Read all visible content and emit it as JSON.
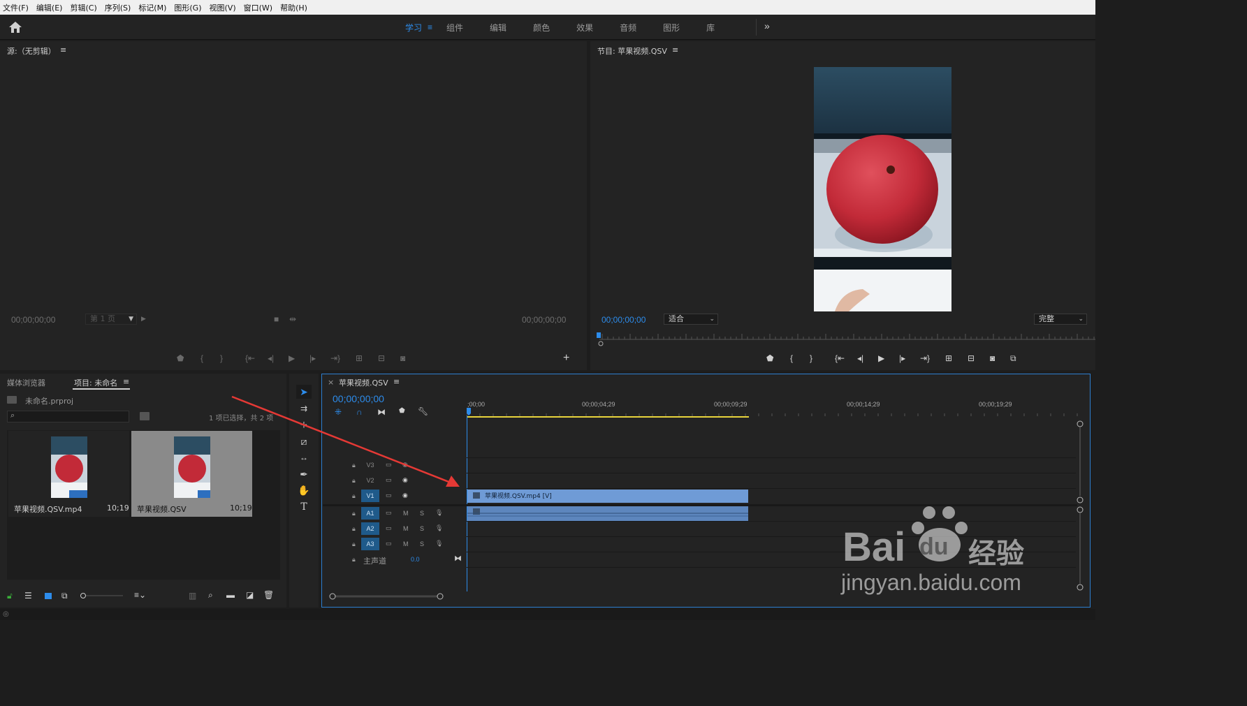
{
  "menu": [
    "文件(F)",
    "编辑(E)",
    "剪辑(C)",
    "序列(S)",
    "标记(M)",
    "图形(G)",
    "视图(V)",
    "窗口(W)",
    "帮助(H)"
  ],
  "workspaces": {
    "active": "学习",
    "menu_glyph": "≡",
    "items": [
      "组件",
      "编辑",
      "颜色",
      "效果",
      "音频",
      "图形",
      "库"
    ],
    "more": "»"
  },
  "source_monitor": {
    "title": "源:（无剪辑）",
    "menu_glyph": "≡",
    "timecode_left": "00;00;00;00",
    "timecode_right": "00;00;00;00",
    "page_select": "第 1 页",
    "add_button": "+"
  },
  "program_monitor": {
    "title": "节目: 苹果视频.QSV",
    "menu_glyph": "≡",
    "timecode": "00;00;00;00",
    "zoom_select": "适合",
    "quality_select": "完整"
  },
  "project_panel": {
    "tab_media_browser": "媒体浏览器",
    "tab_project": "项目: 未命名",
    "menu_glyph": "≡",
    "file_name": "未命名.prproj",
    "selection_status": "1 项已选择，共 2 项",
    "items": [
      {
        "name": "苹果视频.QSV.mp4",
        "duration": "10;19",
        "selected": false
      },
      {
        "name": "苹果视频.QSV",
        "duration": "10;19",
        "selected": true
      }
    ]
  },
  "timeline": {
    "tab_title": "苹果视频.QSV",
    "close_glyph": "×",
    "menu_glyph": "≡",
    "timecode": "00;00;00;00",
    "ruler_labels": [
      ";00;00",
      "00;00;04;29",
      "00;00;09;29",
      "00;00;14;29",
      "00;00;19;29"
    ],
    "video_tracks": [
      "V3",
      "V2",
      "V1"
    ],
    "audio_tracks": [
      "A1",
      "A2",
      "A3"
    ],
    "mute_label": "M",
    "solo_label": "S",
    "master_label": "主声道",
    "master_value": "0.0",
    "clip_label": "苹果视频.QSV.mp4 [V]"
  },
  "watermark": {
    "brand": "Bai",
    "brand2": "du",
    "brand_cn": "经验",
    "url": "jingyan.baidu.com"
  },
  "colors": {
    "accent": "#2d8ceb",
    "clip_video": "#6f9bd6",
    "clip_audio": "#5d86bd",
    "work_area": "#e8d43c",
    "arrow": "#e53935"
  }
}
